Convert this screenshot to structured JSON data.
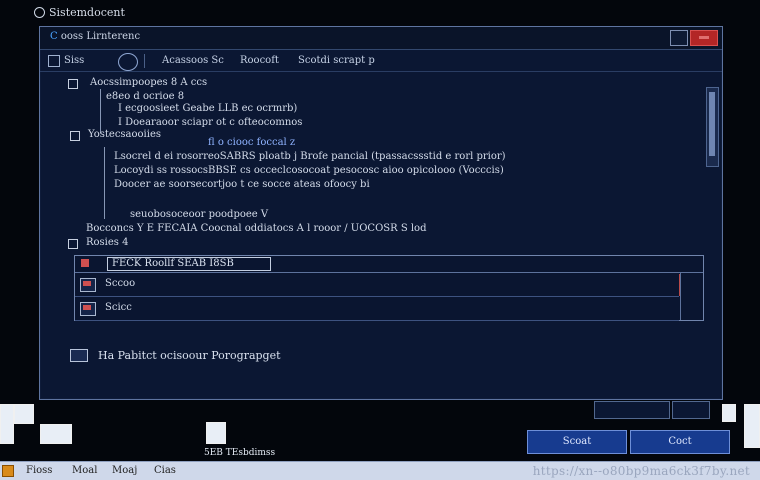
{
  "app": {
    "title": "Sistemdocent"
  },
  "window": {
    "title_prefix": "C",
    "title": "ooss Lirnterenc"
  },
  "toolbar": {
    "items": [
      "Siss",
      "Acassoos Sc",
      "Roocoft",
      "Scotdi scrapt p"
    ]
  },
  "tree": {
    "root": {
      "label": "Aocssimpoopes 8  A  ccs"
    },
    "root_children": [
      "e8eo d  ocrioe 8",
      "I  ecgoosieet  Geabe LLB  ec ocrmrb)",
      "I  Doearaoor  sciapr  ot  c ofteocomnos"
    ],
    "second": {
      "label": "Yostecsaooiies",
      "extra": "fl   o  ciooc  foccal  z"
    },
    "second_children": [
      "Lsocrel d  ei  rosorreoSABRS  ploatb  j  Brofe pancial  (tpassacssstid  e  rorl prior)",
      "Locoydi  ss  rossocsBBSE  cs  occeclcosocoat  pesocosc  aioo  opicolooo  (Vocccis)",
      "Doocer ae  soorsecortjoo  t  ce  socce  ateas  ofoocy  bi",
      "seuobosoceoor  poodpoee  V"
    ],
    "bar": "Bocconcs    Y  E  FECAIA    Coocnal  oddiatocs  A  l  rooor  /  UOCOSR  S  lod",
    "third": {
      "label": "Rosies  4"
    }
  },
  "filter": {
    "header": "FECK  Roollf  SEAB  I8SB",
    "rows": [
      {
        "label": "Sccoo"
      },
      {
        "label": "Scicc"
      }
    ]
  },
  "status": {
    "text": "Ha  Pabitct  ocisoour  Porograpget"
  },
  "buttons": {
    "ok": "Scoat",
    "cancel": "Coct"
  },
  "desktop": {
    "label": "5EB  TEsbdimss"
  },
  "taskbar": {
    "items": [
      "Fioss",
      "Moal",
      "Moaj",
      "Cias"
    ],
    "watermark": "https://xn--o80bp9ma6ck3f7by.net"
  },
  "colors": {
    "window_bg": "#0b1733",
    "accent_button": "#173b8f",
    "close": "#b32626"
  }
}
